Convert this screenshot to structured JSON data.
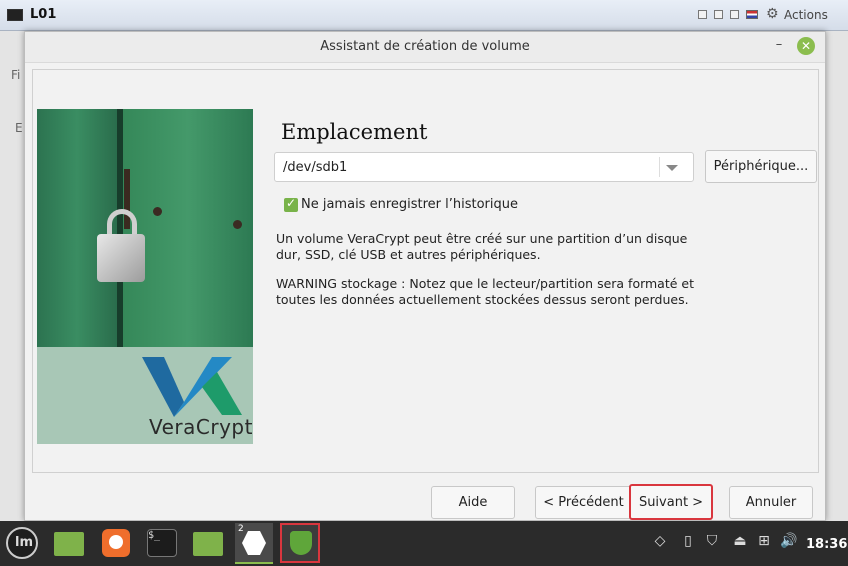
{
  "host": {
    "title": "L01",
    "actions_label": "Actions",
    "bg_text_1": "Fi",
    "bg_text_2": "E"
  },
  "dialog": {
    "title": "Assistant de création de volume",
    "heading": "Emplacement",
    "path_value": "/dev/sdb1",
    "device_button": "Périphérique...",
    "history_checkbox": {
      "label": "Ne jamais enregistrer l’historique",
      "checked": true
    },
    "info_text": "Un volume VeraCrypt peut être créé sur une partition d’un disque dur, SSD, clé USB et autres périphériques.",
    "warning_text": "WARNING stockage : Notez que le lecteur/partition sera formaté et toutes les données actuellement stockées dessus seront perdues.",
    "brand": "VeraCrypt",
    "buttons": {
      "help": "Aide",
      "previous": "< Précédent",
      "next": "Suivant >",
      "cancel": "Annuler"
    }
  },
  "taskbar": {
    "veracrypt_badge": "2",
    "terminal_glyph": "$_",
    "clock": "18:36"
  },
  "colors": {
    "accent_green": "#8bbd4e",
    "highlight_red": "#d9363e"
  }
}
